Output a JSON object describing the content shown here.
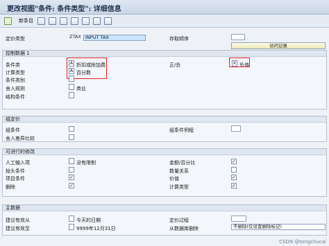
{
  "window": {
    "title": "更改视图\"条件: 条件类型\": 详细信息"
  },
  "toolbar": {
    "new_entries": "新条目"
  },
  "header": {
    "cond_type_label": "定价类型",
    "cond_type_code": "ZTAX",
    "cond_type_name": "INPUT TAX",
    "access_seq_label": "存取顺序",
    "access_seq_value": "",
    "records_button": "访问记录"
  },
  "control1": {
    "title": "控制数据 1",
    "cond_class_label": "条件类",
    "cond_class_ind": "A",
    "cond_class_value": "折扣或附加费",
    "calc_type_label": "计算类型",
    "calc_type_ind": "A",
    "calc_type_value": "百分数",
    "cond_category_label": "条件类别",
    "rounding_label": "舍入规则",
    "rounding_value": "商业",
    "struct_cond_label": "结构条件",
    "plus_minus_label": "正/负",
    "plus_minus_ind": "X",
    "plus_minus_value": "负值"
  },
  "group_cond": {
    "title": "组定价",
    "group_cond_label": "组条件",
    "group_routine_label": "组条件例程",
    "rounding_diff_label": "舍入差异比较"
  },
  "changes": {
    "title": "可进行的修改",
    "manual_entry_label": "人工输入项",
    "manual_entry_value": "没有限制",
    "header_cond_label": "抬头条件",
    "item_cond_label": "项目条件",
    "delete_label": "删除",
    "amount_pct_label": "金额/百分比",
    "qty_relation_label": "数量关系",
    "value_label": "价值",
    "calc_type_label": "计算类型",
    "checked": {
      "header_cond": false,
      "item_cond": true,
      "delete": true,
      "amount_pct": true,
      "qty_relation": false,
      "value": true,
      "calc_type": true
    }
  },
  "master": {
    "title": "主数据",
    "valid_from_label": "建议有效从",
    "valid_from_value": "今天的日期",
    "valid_to_label": "建议有效至",
    "valid_to_value": "9999年12月31日",
    "pricing_proc_label": "定价过程",
    "delete_from_db_label": "从数据库删除",
    "delete_from_db_value": "不删除(仅设置删除标记)"
  },
  "watermark": "CSDN @tongchucai"
}
